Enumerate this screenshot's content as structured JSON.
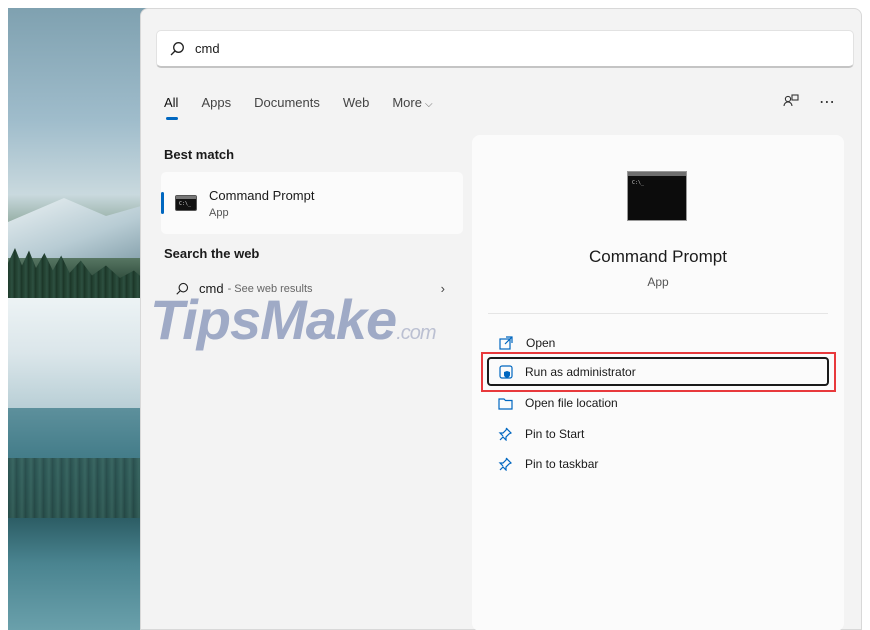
{
  "search": {
    "query": "cmd"
  },
  "tabs": [
    {
      "label": "All"
    },
    {
      "label": "Apps"
    },
    {
      "label": "Documents"
    },
    {
      "label": "Web"
    },
    {
      "label": "More"
    }
  ],
  "best_match": {
    "title": "Best match",
    "name": "Command Prompt",
    "type": "App"
  },
  "web": {
    "title": "Search the web",
    "query": "cmd",
    "sub": "- See web results"
  },
  "preview": {
    "name": "Command Prompt",
    "type": "App",
    "actions": [
      {
        "label": "Open",
        "icon": "open-icon"
      },
      {
        "label": "Run as administrator",
        "icon": "shield-icon"
      },
      {
        "label": "Open file location",
        "icon": "folder-icon"
      },
      {
        "label": "Pin to Start",
        "icon": "pin-icon"
      },
      {
        "label": "Pin to taskbar",
        "icon": "pin-icon"
      }
    ]
  },
  "watermark": {
    "brand": "TipsMake",
    "tld": ".com"
  },
  "colors": {
    "accent": "#0067c0",
    "highlight": "#e8393c"
  }
}
